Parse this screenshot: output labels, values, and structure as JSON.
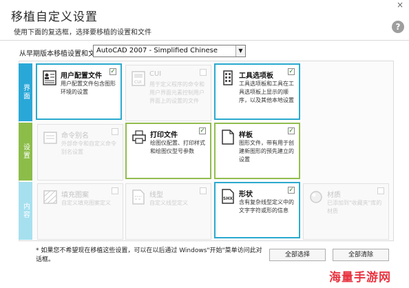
{
  "window": {
    "title": "移植自定义设置",
    "subtitle": "使用下面的复选框，选择要移植的设置和文件",
    "help_label": "?",
    "close_label": "×"
  },
  "source": {
    "label": "从早期版本移植设置和文件:",
    "selected": "AutoCAD 2007 - Simplified Chinese"
  },
  "rows": [
    {
      "label": "界面",
      "color": "#29a8d8"
    },
    {
      "label": "设置",
      "color": "#8cbd49"
    },
    {
      "label": "内容",
      "color": "#a6e0ef"
    }
  ],
  "cards": [
    {
      "title": "用户配置文件",
      "desc": "用户配置文件包含图形环境的设置",
      "checked": true,
      "enabled": true,
      "icon": "profile-icon",
      "mark": "✓"
    },
    {
      "title": "CUI",
      "desc": "用于定义程序的命令和用户界面元素控制用户界面上的设置的文件",
      "checked": false,
      "enabled": false,
      "icon": "cui-icon",
      "mark": ""
    },
    {
      "title": "工具选项板",
      "desc": "工具选项板和工具在工具选项板上显示的顺序，以及其他本地设置",
      "checked": true,
      "enabled": true,
      "icon": "tool-palette-icon",
      "mark": "✓"
    },
    {
      "title": "命令别名",
      "desc": "外部命令和自定义命令别名设置",
      "checked": false,
      "enabled": false,
      "icon": "command-alias-icon",
      "mark": ""
    },
    {
      "title": "打印文件",
      "desc": "绘图仪配置、打印样式和绘图仪型号参数",
      "checked": true,
      "enabled": true,
      "icon": "printer-icon",
      "mark": "✓"
    },
    {
      "title": "样板",
      "desc": "图形文件，带有用于创建新图形的预先建立的设置",
      "checked": true,
      "enabled": true,
      "icon": "template-icon",
      "mark": "✓"
    },
    {
      "title": "填充图案",
      "desc": "自定义填充图案定义",
      "checked": false,
      "enabled": false,
      "icon": "hatch-pattern-icon",
      "mark": ""
    },
    {
      "title": "线型",
      "desc": "自定义线型定义",
      "checked": false,
      "enabled": false,
      "icon": "linetype-icon",
      "mark": ""
    },
    {
      "title": "形状",
      "desc": "含有复杂线型定义中的文字字符或形的信息",
      "checked": true,
      "enabled": true,
      "icon": "shape-icon",
      "mark": "✓"
    },
    {
      "title": "材质",
      "desc": "已添加到\"收藏夹\"库的材质",
      "checked": false,
      "enabled": false,
      "icon": "material-icon",
      "mark": ""
    }
  ],
  "footer": {
    "note": "* 如果您不希望现在移植这些设置，可以在以后通过 Windows\"开始\"菜单访问此对话框。",
    "select_all": "全部选择",
    "clear_all": "全部清除"
  },
  "watermark": "海量手游网"
}
